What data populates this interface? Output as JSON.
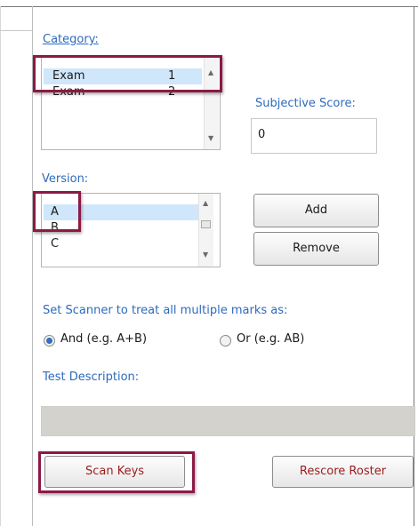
{
  "category": {
    "label": "Category:",
    "items": [
      {
        "name": "Exam",
        "number": "1"
      },
      {
        "name": "Exam",
        "number": "2"
      }
    ]
  },
  "subjective_score": {
    "label": "Subjective Score:",
    "value": "0"
  },
  "version": {
    "label": "Version:",
    "items": [
      "A",
      "B",
      "C"
    ]
  },
  "buttons": {
    "add": "Add",
    "remove": "Remove",
    "scan_keys": "Scan Keys",
    "rescore_roster": "Rescore Roster"
  },
  "multiple_marks": {
    "label": "Set Scanner to treat all multiple marks as:",
    "options": [
      {
        "label": "And (e.g. A+B)",
        "checked": true
      },
      {
        "label": "Or (e.g. AB)",
        "checked": false
      }
    ]
  },
  "test_description": {
    "label": "Test Description:",
    "value": ""
  },
  "colors": {
    "accent_blue": "#2d6bbd",
    "highlight": "#8b1a45",
    "selection": "#cfe6fb",
    "rescore_text": "#9b1c1c"
  }
}
